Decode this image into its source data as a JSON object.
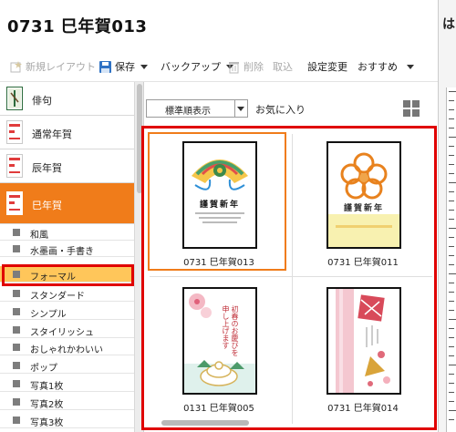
{
  "window": {
    "title": "0731  巳年賀013"
  },
  "right_peek": {
    "char": "は"
  },
  "toolbar": {
    "new_layout": "新規レイアウト",
    "save": "保存",
    "backup": "バックアップ",
    "delete": "削除",
    "import": "取込",
    "settings": "設定変更",
    "recommend": "おすすめ"
  },
  "sidebar": {
    "categories": [
      {
        "label": "俳句"
      },
      {
        "label": "通常年賀"
      },
      {
        "label": "辰年賀"
      },
      {
        "label": "巳年賀"
      }
    ],
    "subcategories": [
      "和風",
      "水墨画・手書き",
      "フォーマル",
      "スタンダード",
      "シンプル",
      "スタイリッシュ",
      "おしゃれかわいい",
      "ポップ",
      "写真1枚",
      "写真2枚",
      "写真3枚"
    ],
    "selected_subcategory": "フォーマル"
  },
  "main": {
    "sort_label": "標準順表示",
    "favorites_label": "お気に入り",
    "cards": [
      {
        "name": "0731  巳年賀013",
        "thumb_text": "謹賀新年"
      },
      {
        "name": "0731  巳年賀011",
        "thumb_text": "謹賀新年"
      },
      {
        "name": "0131  巳年賀005",
        "thumb_text": "初春のお慶びを申し上げます"
      },
      {
        "name": "0731  巳年賀014",
        "thumb_text": ""
      }
    ]
  },
  "colors": {
    "accent_orange": "#f07c1a",
    "selected_sub": "#ffc65a",
    "highlight_red": "#e00000"
  }
}
